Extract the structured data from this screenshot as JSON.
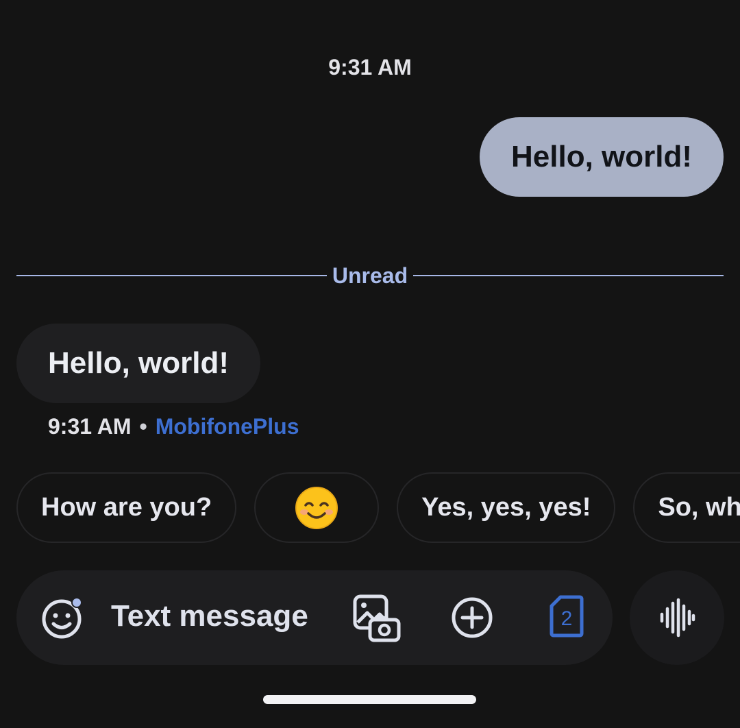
{
  "conversation": {
    "top_timestamp": "9:31 AM",
    "outgoing_message": "Hello, world!",
    "unread_label": "Unread",
    "incoming_message": "Hello, world!",
    "incoming_time": "9:31 AM",
    "separator": "•",
    "sim_name": "MobifonePlus"
  },
  "smart_replies": [
    {
      "label": "How are you?"
    },
    {
      "label": "😊"
    },
    {
      "label": "Yes, yes, yes!"
    },
    {
      "label": "So, wha"
    }
  ],
  "composer": {
    "placeholder": "Text message",
    "sim_badge_number": "2",
    "icons": [
      "emoji-icon",
      "gallery-camera-icon",
      "add-icon",
      "sim-card-icon",
      "voice-waveform-icon"
    ]
  },
  "colors": {
    "background": "#141414",
    "outgoing_bubble": "#a9b1c6",
    "incoming_bubble": "#1f1f21",
    "accent_blue": "#3d6fd1",
    "unread_divider": "#a7b7e6"
  }
}
